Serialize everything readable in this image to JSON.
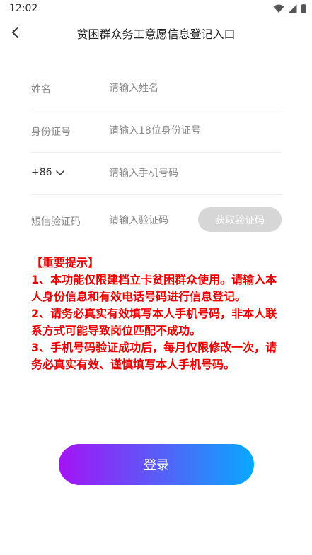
{
  "status_bar": {
    "time": "12:02"
  },
  "nav": {
    "title": "贫困群众务工意愿信息登记入口"
  },
  "form": {
    "name": {
      "label": "姓名",
      "placeholder": "请输入姓名"
    },
    "id_card": {
      "label": "身份证号",
      "placeholder": "请输入18位身份证号"
    },
    "phone": {
      "country_code": "+86",
      "placeholder": "请输入手机号码"
    },
    "sms": {
      "label": "短信验证码",
      "placeholder": "请输入验证码",
      "button": "获取验证码"
    }
  },
  "notice": {
    "heading": "【重要提示】",
    "lines": [
      "1、本功能仅限建档立卡贫困群众使用。请输入本人身份信息和有效电话号码进行信息登记。",
      "2、请务必真实有效填写本人手机号码，非本人联系方式可能导致岗位匹配不成功。",
      "3、手机号码验证成功后，每月仅限修改一次，请务必真实有效、谨慎填写本人手机号码。"
    ]
  },
  "login": {
    "label": "登录"
  },
  "colors": {
    "notice": "#ee0000",
    "button_gradient_start": "#a413f5",
    "button_gradient_end": "#08a9ff",
    "code_button": "#d6d6d6"
  },
  "icons": {
    "back": "chevron-left-icon",
    "dropdown": "chevron-down-icon",
    "wifi": "wifi-icon",
    "signal": "signal-icon",
    "battery": "battery-icon"
  }
}
